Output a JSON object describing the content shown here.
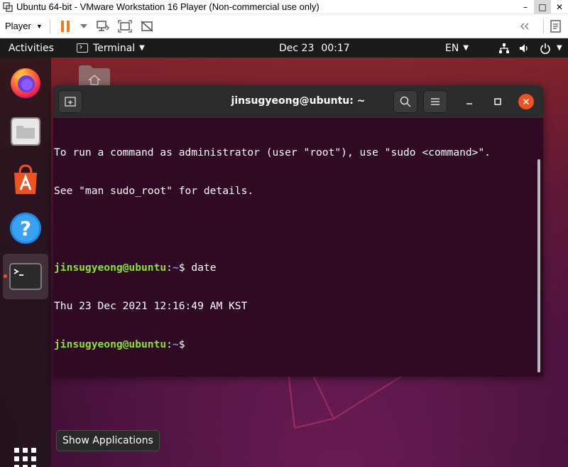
{
  "vmware": {
    "window_title": "Ubuntu 64-bit - VMware Workstation 16 Player (Non-commercial use only)",
    "player_menu_label": "Player",
    "controls": {
      "minimize": "–",
      "maximize": "□",
      "close": "✕"
    }
  },
  "top_panel": {
    "activities": "Activities",
    "app_name": "Terminal",
    "date": "Dec 23",
    "time": "00:17",
    "input_language": "EN"
  },
  "terminal": {
    "title": "jinsugyeong@ubuntu: ~",
    "lines": {
      "l1": "To run a command as administrator (user \"root\"), use \"sudo <command>\".",
      "l2": "See \"man sudo_root\" for details.",
      "p1_user": "jinsugyeong@ubuntu",
      "p1_path": "~",
      "p1_cmd": " date",
      "out1": "Thu 23 Dec 2021 12:16:49 AM KST",
      "p2_user": "jinsugyeong@ubuntu",
      "p2_path": "~"
    },
    "prompt_colon": ":",
    "prompt_dollar": "$"
  },
  "dock": {
    "items": [
      "firefox-icon",
      "files-icon",
      "ubuntu-software-icon",
      "help-icon",
      "terminal-icon"
    ],
    "show_applications_tooltip": "Show Applications"
  },
  "colors": {
    "ubuntu_orange": "#e95420",
    "terminal_bg": "#300a24",
    "prompt_user": "#8ae234",
    "prompt_path": "#729fcf"
  }
}
